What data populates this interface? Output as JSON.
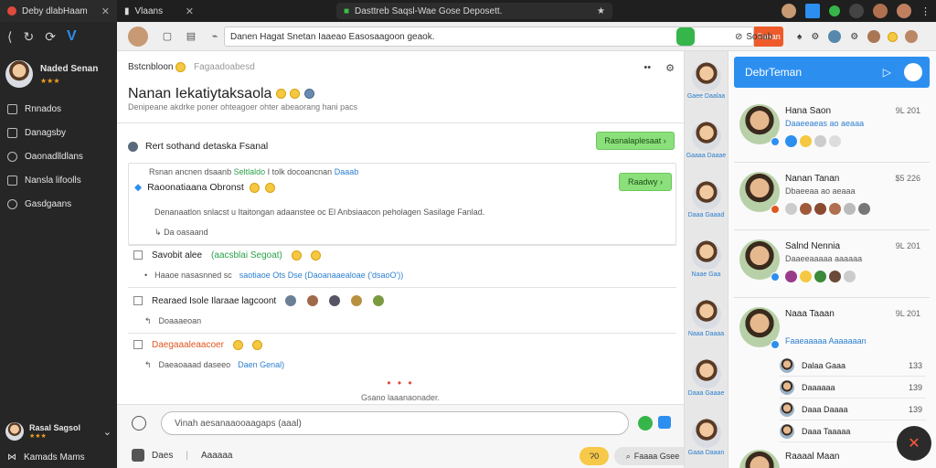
{
  "browser": {
    "tabs": [
      {
        "label": "Deby dlabHaam"
      },
      {
        "label": "Vlaans"
      }
    ],
    "address": "Dasttreb Saqsl-Wae Gose Deposett."
  },
  "sidebar": {
    "profile": {
      "name": "Naded Senan",
      "stars": "★★★"
    },
    "items": [
      {
        "label": "Rnnados"
      },
      {
        "label": "Danagsby"
      },
      {
        "label": "Oaonadlldlans"
      },
      {
        "label": "Nansla lifoolls"
      },
      {
        "label": "Gasdgaans"
      }
    ],
    "user": {
      "name": "Rasal Sagsol",
      "stars": "★★★"
    },
    "footer": "Kamads Mams"
  },
  "toolbar": {
    "search_value": "Danen   Hagat  Snetan   Iaaeao Easosaagoon   geaok.",
    "search_button": "Fanan",
    "chat_label": "Sonab"
  },
  "main": {
    "breadcrumb": "Bstcnbloon",
    "breadcrumb_ghost": "Fagaadoabesd",
    "title": "Nanan Iekatiytaksaola",
    "subtitle": "Denipeane akdrke poner ohteagoer ohter abeaorang hani pacs",
    "section_title": "Rert sothand detaska Fsanal",
    "section_button": "Rasnalaplesaat",
    "card": {
      "line1_prefix": "Rsnan ancnen dsaanb",
      "line1_green": "Seltlaldo",
      "line1_mid": "I tolk docoancnan",
      "line1_blue": "Daaab",
      "line2": "Raoonatiaana Obronst",
      "button": "Raadwy",
      "line3": "Denanaatlon snlacst u Itaitongan adaanstee oc El Anbsiaacon peholagen Sasilage Fanlad.",
      "line4": "Da oasaand"
    },
    "tasks": [
      {
        "prefix": "Savobit alee",
        "highlight": "(aacsblai Segoat)",
        "sub_prefix": "Haaoe nasasnned sc",
        "sub_blue": "saotiaoe Ots Dse (Daoanaaealoae ('dsaoO'))"
      },
      {
        "prefix": "Rearaed Isole Ilaraae lagcoont",
        "sub_prefix": "Doaaaeoan"
      },
      {
        "prefix": "Daegaaaleaacoer",
        "sub_prefix": "Daeaoaaad daseeo",
        "sub_blue": "Daen Genal)"
      }
    ],
    "load_more": "Gsano laaanaonader.",
    "composer_placeholder": "Vinah aesanaaooaagaps (aaal)",
    "composer_tab1": "Daes",
    "composer_tab2": "Aaaaaa",
    "composer_pill_yellow": "Ɂ0",
    "composer_pill_gray": "Faaaa Gsee"
  },
  "strip": [
    {
      "label": "Gaee Daalaa"
    },
    {
      "label": "Gaaaa Daaae"
    },
    {
      "label": "Daaa Gaaad"
    },
    {
      "label": "Naae Gaa"
    },
    {
      "label": "Naaa Daaaa"
    },
    {
      "label": "Daaa Gaaae"
    },
    {
      "label": "Gaaa Daaan"
    }
  ],
  "right": {
    "header": "DebrTeman",
    "contacts": [
      {
        "name": "Hana Saon",
        "time": "9L 201",
        "sub": "Daaeeaeas ao aeaaa"
      },
      {
        "name": "Nanan Tanan",
        "time": "$5 226",
        "sub": "Dbaeeaa ao aeaaa"
      },
      {
        "name": "Salnd Nennia",
        "time": "9L 201",
        "sub": "Daaeeaaaaa aaaaaa"
      },
      {
        "name": "Naaa Taaan",
        "time": "9L 201",
        "sub": "Faaeaaaaa Aaaaaaan"
      }
    ],
    "mini": [
      {
        "name": "Dalaa Gaaa",
        "num": "133"
      },
      {
        "name": "Daaaaaa",
        "num": "139"
      },
      {
        "name": "Daaa Daaaa",
        "num": "139"
      },
      {
        "name": "Daaa Taaaaa",
        "num": ""
      }
    ],
    "last": {
      "name": "Raaaal Maan"
    }
  },
  "colors": {
    "accent": "#2c8ff0",
    "green": "#2aa24a",
    "orange": "#e0561e"
  }
}
